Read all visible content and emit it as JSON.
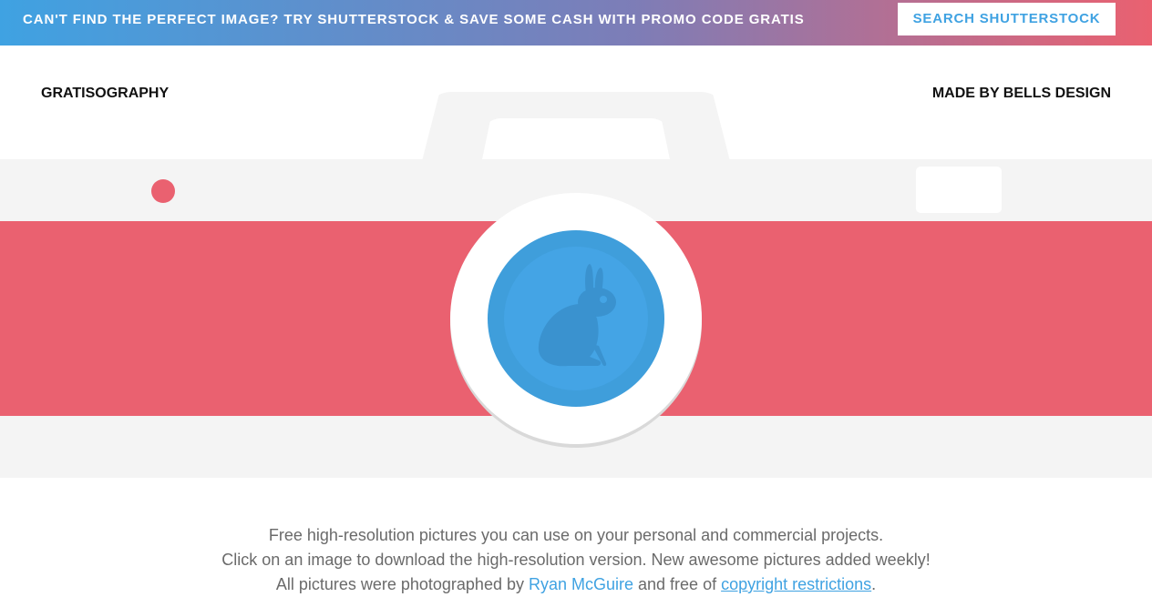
{
  "promo": {
    "text": "CAN'T FIND THE PERFECT IMAGE? TRY SHUTTERSTOCK & SAVE SOME CASH WITH PROMO CODE GRATIS",
    "button_label": "SEARCH SHUTTERSTOCK"
  },
  "header": {
    "logo": "GRATISOGRAPHY",
    "credit": "MADE BY BELLS DESIGN"
  },
  "hero": {
    "icon": "camera-illustration",
    "lens_icon": "rabbit-icon"
  },
  "intro": {
    "line1": "Free high-resolution pictures you can use on your personal and commercial projects.",
    "line2": "Click on an image to download the high-resolution version. New awesome pictures added weekly!",
    "line3_prefix": "All pictures were photographed by ",
    "author_link": "Ryan McGuire",
    "line3_middle": " and free of ",
    "copyright_link": "copyright restrictions",
    "line3_suffix": "."
  },
  "colors": {
    "accent_blue": "#3fa2e2",
    "accent_red": "#ea6170",
    "camera_gray": "#f4f4f4"
  }
}
